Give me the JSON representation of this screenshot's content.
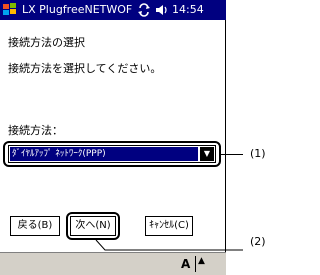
{
  "titlebar": {
    "title": "LX PlugfreeNETWOF",
    "time": "14:54",
    "sync_glyph": "⟲",
    "volume_glyph": "◀("
  },
  "content": {
    "heading": "接続方法の選択",
    "instruction": "接続方法を選択してください。",
    "method_label": "接続方法："
  },
  "combo": {
    "value": "ﾀﾞｲﾔﾙｱｯﾌﾟ ﾈｯﾄﾜｰｸ(PPP)",
    "arrow_glyph": "▼"
  },
  "buttons": {
    "back": "戻る(B)",
    "next": "次へ(N)",
    "cancel": "ｷｬﾝｾﾙ(C)"
  },
  "callouts": {
    "label1": "(1)",
    "label2": "(2)"
  },
  "ime": {
    "mode": "A",
    "arrow": "▲"
  },
  "icons": {
    "start": "windows-flag-icon",
    "sync": "sync-icon",
    "volume": "volume-icon"
  },
  "colors": {
    "titlebar": "#000080",
    "selection": "#000080"
  }
}
